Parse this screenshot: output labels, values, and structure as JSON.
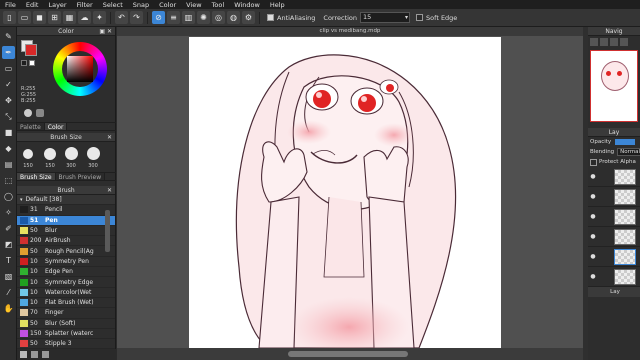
{
  "menu": [
    "File",
    "Edit",
    "Layer",
    "Filter",
    "Select",
    "Snap",
    "Color",
    "View",
    "Tool",
    "Window",
    "Help"
  ],
  "toolbar": {
    "antialiasing_label": "AntiAliasing",
    "correction_label": "Correction",
    "correction_value": "15",
    "soft_edge_label": "Soft Edge"
  },
  "document": {
    "title": "clip vs medibang.mdp"
  },
  "color_panel": {
    "title": "Color",
    "r": "R:255",
    "g": "G:255",
    "b": "B:255",
    "tab_palette": "Palette",
    "tab_color": "Color"
  },
  "brush_size": {
    "title": "Brush Size",
    "sizes": [
      "150",
      "150",
      "300",
      "300"
    ],
    "tab_size": "Brush Size",
    "tab_preview": "Brush Preview"
  },
  "brush": {
    "title": "Brush",
    "group": "Default [38]",
    "items": [
      {
        "size": "31",
        "name": "Pencil",
        "color": "#1e1e1e"
      },
      {
        "size": "51",
        "name": "Pen",
        "color": "#1a5aa8"
      },
      {
        "size": "50",
        "name": "Blur",
        "color": "#e8e060"
      },
      {
        "size": "200",
        "name": "AirBrush",
        "color": "#d03030"
      },
      {
        "size": "50",
        "name": "Rough Pencil(Ag",
        "color": "#e0a030"
      },
      {
        "size": "10",
        "name": "Symmetry Pen",
        "color": "#d02020"
      },
      {
        "size": "10",
        "name": "Edge Pen",
        "color": "#30b030"
      },
      {
        "size": "10",
        "name": "Symmetry Edge",
        "color": "#20a020"
      },
      {
        "size": "10",
        "name": "Watercolor(Wet",
        "color": "#70c8e8"
      },
      {
        "size": "10",
        "name": "Flat Brush (Wet)",
        "color": "#50a8e0"
      },
      {
        "size": "70",
        "name": "Finger",
        "color": "#e0c8a0"
      },
      {
        "size": "50",
        "name": "Blur (Soft)",
        "color": "#e0e060"
      },
      {
        "size": "150",
        "name": "Splatter (waterc",
        "color": "#c050e0"
      },
      {
        "size": "50",
        "name": "Stipple 3",
        "color": "#e04040"
      }
    ]
  },
  "right_panel": {
    "navigator_title": "Navig",
    "layer_title": "Lay",
    "opacity_label": "Opacity",
    "blending_label": "Blending",
    "blending_value": "Normal",
    "protect_alpha_label": "Protect Alpha",
    "footer_label": "Lay"
  }
}
